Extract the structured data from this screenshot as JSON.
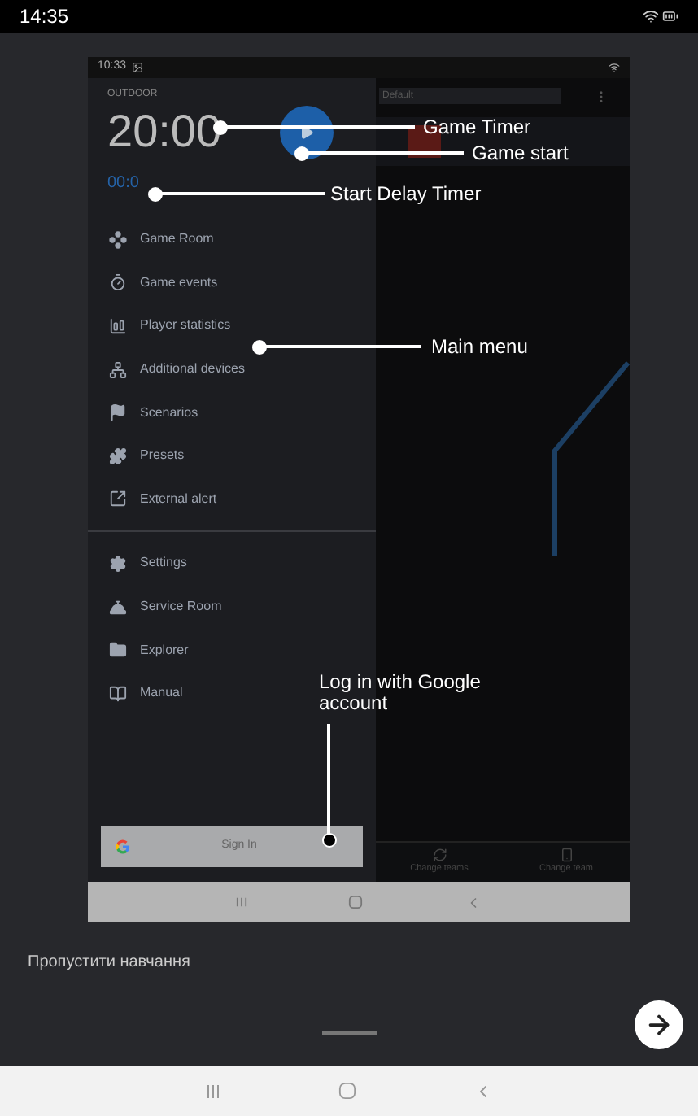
{
  "status_bar": {
    "time": "14:35"
  },
  "app_screenshot": {
    "status_bar": {
      "time": "10:33"
    },
    "drawer": {
      "mode": "OUTDOOR",
      "game_timer": "20:00",
      "start_delay": "00:0",
      "menu_groups": [
        [
          "Game Room",
          "Game events",
          "Player statistics",
          "Additional devices",
          "Scenarios",
          "Presets",
          "External alert"
        ],
        [
          "Settings",
          "Service Room",
          "Explorer",
          "Manual"
        ]
      ],
      "sign_in": "Sign In"
    },
    "main_area": {
      "preset_field": "Default",
      "bottom_actions": [
        "Change teams",
        "Change team"
      ]
    }
  },
  "annotations": [
    {
      "text": "Game Timer"
    },
    {
      "text": "Game start"
    },
    {
      "text": "Start Delay Timer"
    },
    {
      "text": "Main menu"
    },
    {
      "text": "Log in with Google account"
    }
  ],
  "tutorial": {
    "skip_label": "Пропустити навчання"
  }
}
